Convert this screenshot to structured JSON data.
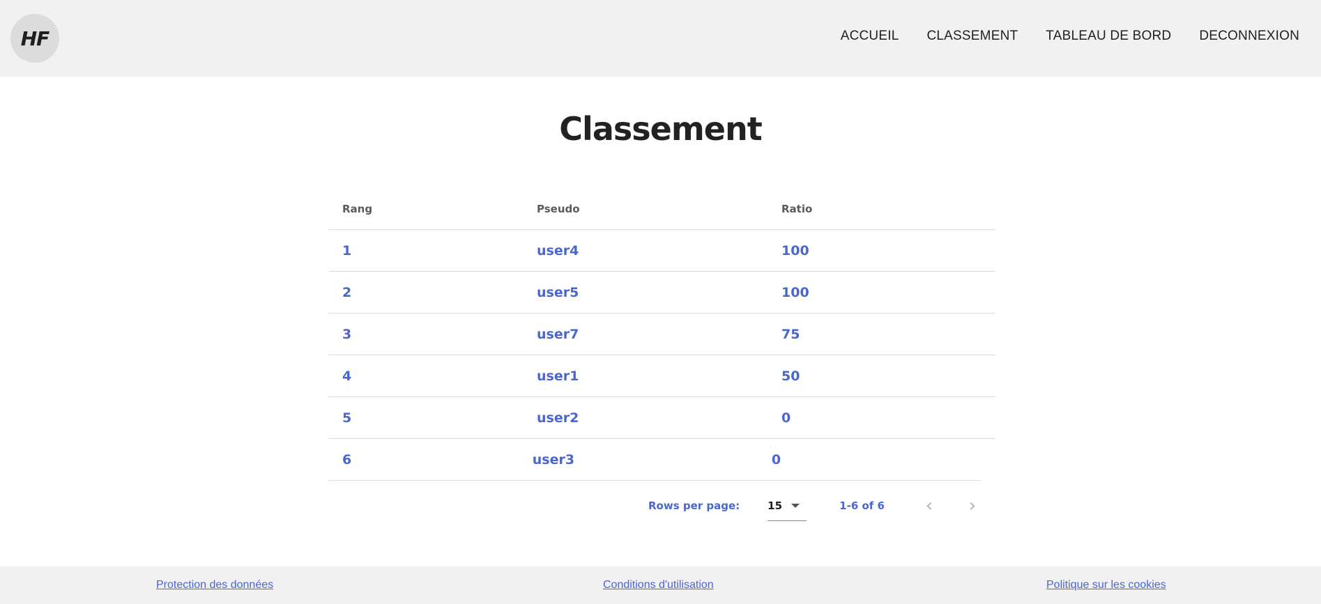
{
  "header": {
    "logo_text": "HF",
    "nav": [
      "ACCUEIL",
      "CLASSEMENT",
      "TABLEAU DE BORD",
      "DECONNEXION"
    ]
  },
  "page": {
    "title": "Classement"
  },
  "table": {
    "columns": [
      "Rang",
      "Pseudo",
      "Ratio"
    ],
    "rows": [
      [
        "1",
        "user4",
        "100"
      ],
      [
        "2",
        "user5",
        "100"
      ],
      [
        "3",
        "user7",
        "75"
      ],
      [
        "4",
        "user1",
        "50"
      ],
      [
        "5",
        "user2",
        "0"
      ],
      [
        "6",
        "user3",
        "0"
      ]
    ]
  },
  "pagination": {
    "rows_per_page_label": "Rows per page:",
    "rows_per_page_value": "15",
    "range": "1-6 of 6",
    "prev_icon": "chevron-left-icon",
    "next_icon": "chevron-right-icon"
  },
  "footer": {
    "links": [
      "Protection des données",
      "Conditions d'utilisation",
      "Politique sur les cookies"
    ]
  },
  "colors": {
    "accent": "#4a66cf",
    "header_bg": "#f1f1f1",
    "text": "#222222"
  }
}
